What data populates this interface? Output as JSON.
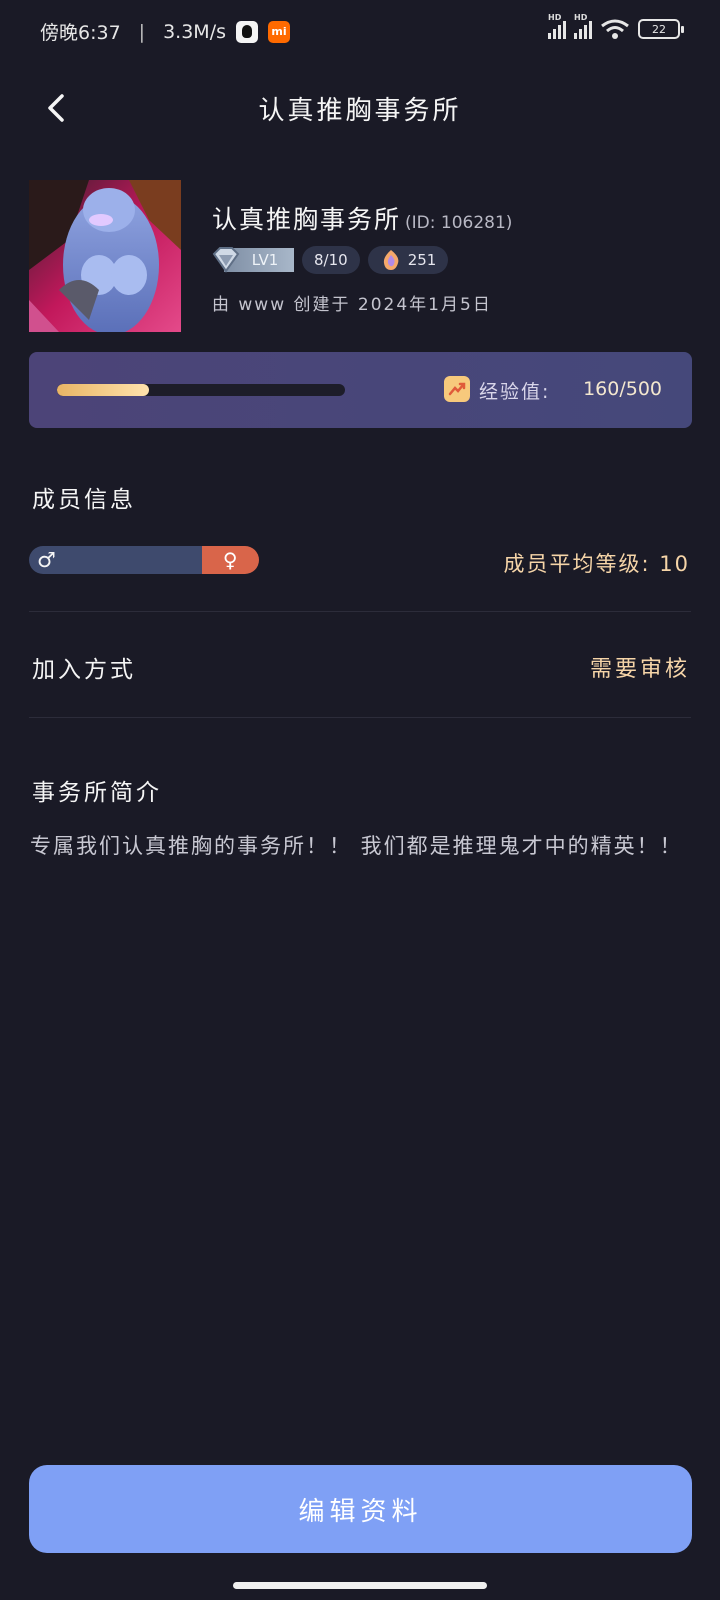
{
  "status_bar": {
    "time": "傍晚6:37",
    "speed": "3.3M/s",
    "battery": "22",
    "signal_hd_1": "HD",
    "signal_hd_2": "HD"
  },
  "header": {
    "title": "认真推胸事务所",
    "back_icon": "chevron-left-icon"
  },
  "profile": {
    "name": "认真推胸事务所",
    "id_text": "(ID: 106281)",
    "level": "LV1",
    "members": "8/10",
    "points": "251",
    "creator_text": "由 www 创建于 2024年1月5日"
  },
  "experience": {
    "label": "经验值:",
    "value": "160/500",
    "progress": 0.32,
    "icon": "trend-up-icon"
  },
  "members_section": {
    "title": "成员信息",
    "male_symbol": "♂",
    "female_symbol": "♀",
    "male_ratio": 0.75,
    "avg_level_text": "成员平均等级: 10"
  },
  "join_section": {
    "title": "加入方式",
    "value": "需要审核"
  },
  "intro_section": {
    "title": "事务所简介",
    "text": "专属我们认真推胸的事务所！！ 我们都是推理鬼才中的精英！！"
  },
  "edit_button": {
    "label": "编辑资料"
  },
  "colors": {
    "background": "#1a1a26",
    "accent_gold": "#f6d5a8",
    "button_blue": "#7fa0f5",
    "female": "#d9654a",
    "male": "#3e4a6d"
  }
}
